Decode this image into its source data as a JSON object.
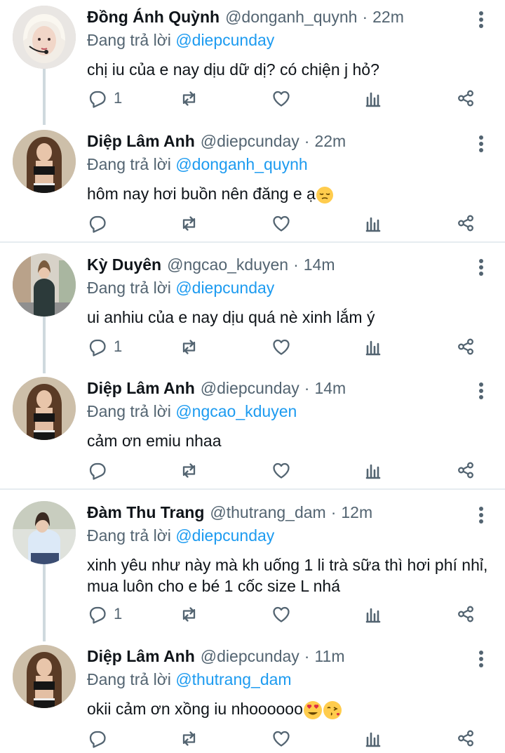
{
  "reply_prefix": "Đang trả lời",
  "colors": {
    "accent": "#1d9bf0",
    "muted": "#536471",
    "text": "#0f1419",
    "divider": "#e6ecf0"
  },
  "tweets": [
    {
      "name": "Đồng Ánh Quỳnh",
      "handle": "@donganh_quynh",
      "sep": "·",
      "time": "22m",
      "reply_to": "@diepcunday",
      "text": "chị iu của e nay dịu dữ dị? có chiện j hỏ?",
      "reply_count": "1"
    },
    {
      "name": "Diệp Lâm Anh",
      "handle": "@diepcunday",
      "sep": "·",
      "time": "22m",
      "reply_to": "@donganh_quynh",
      "text": "hôm nay hơi buồn nên đăng e ạ",
      "emoji": "pensive-face",
      "reply_count": ""
    },
    {
      "name": "Kỳ Duyên",
      "handle": "@ngcao_kduyen",
      "sep": "·",
      "time": "14m",
      "reply_to": "@diepcunday",
      "text": "ui anhiu của e nay dịu quá nè xinh lắm ý",
      "reply_count": "1"
    },
    {
      "name": "Diệp Lâm Anh",
      "handle": "@diepcunday",
      "sep": "·",
      "time": "14m",
      "reply_to": "@ngcao_kduyen",
      "text": "cảm ơn emiu nhaa",
      "reply_count": ""
    },
    {
      "name": "Đàm Thu Trang",
      "handle": "@thutrang_dam",
      "sep": "·",
      "time": "12m",
      "reply_to": "@diepcunday",
      "text": "xinh yêu như này mà kh uống 1 li trà sữa thì hơi phí nhỉ, mua luôn cho e bé 1 cốc size L nhá",
      "reply_count": "1"
    },
    {
      "name": "Diệp Lâm Anh",
      "handle": "@diepcunday",
      "sep": "·",
      "time": "11m",
      "reply_to": "@thutrang_dam",
      "text": "okii cảm ơn xồng iu nhoooooo",
      "emoji": "heart-eyes-face, kissing-heart-face",
      "reply_count": ""
    }
  ]
}
